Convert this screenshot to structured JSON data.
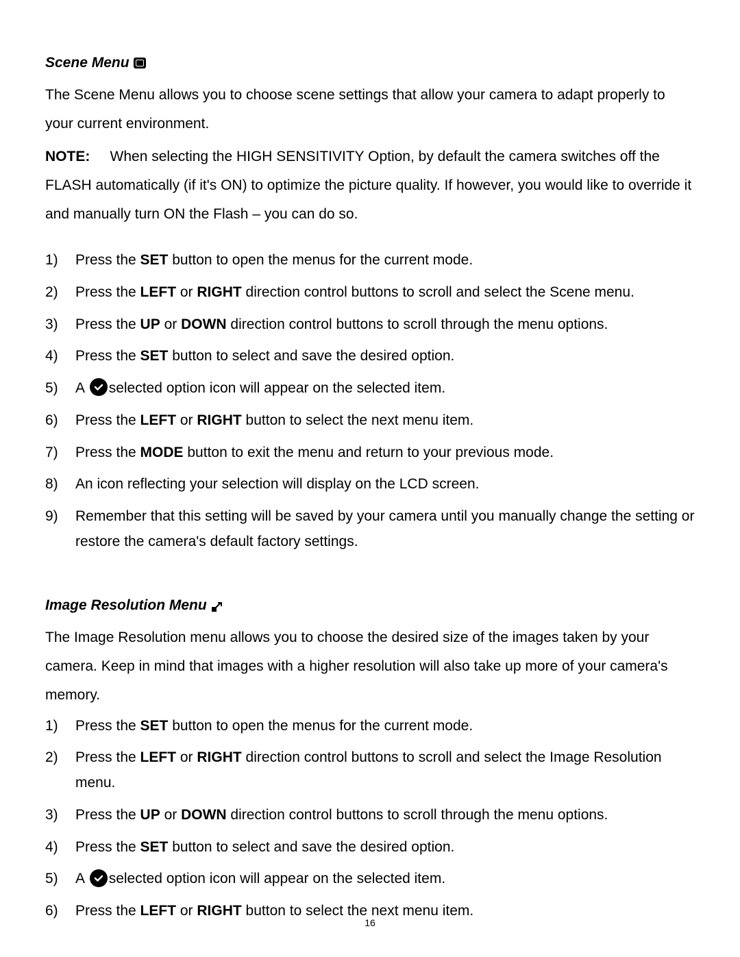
{
  "section1": {
    "heading": "Scene Menu",
    "intro": "The Scene Menu allows you to choose scene settings that allow your camera to adapt properly to your current environment.",
    "noteLabel": "NOTE:",
    "noteText": "When selecting the HIGH SENSITIVITY Option, by default the camera switches off the FLASH automatically (if it's ON) to optimize the picture quality. If however, you would like to override it and manually turn ON the Flash – you can do so.",
    "steps": [
      {
        "n": "1)",
        "pre": "Press the ",
        "bold": "SET",
        "post": " button to open the menus for the current mode."
      },
      {
        "n": "2)",
        "pre": "Press the ",
        "bold": "LEFT",
        "mid": " or ",
        "bold2": "RIGHT",
        "post": " direction control buttons to scroll and select the Scene menu."
      },
      {
        "n": "3)",
        "pre": "Press the ",
        "bold": "UP",
        "mid": " or ",
        "bold2": "DOWN",
        "post": " direction control buttons to scroll through the menu options."
      },
      {
        "n": "4)",
        "pre": "Press the ",
        "bold": "SET",
        "post": " button to select and save the desired option."
      },
      {
        "n": "5)",
        "pre": "A ",
        "icon": true,
        "post": "selected option icon will appear on the selected item."
      },
      {
        "n": "6)",
        "pre": "Press the ",
        "bold": "LEFT",
        "mid": " or ",
        "bold2": "RIGHT",
        "post": " button to select the next menu item."
      },
      {
        "n": "7)",
        "pre": "Press the ",
        "bold": "MODE",
        "post": " button to exit the menu and return to your previous mode."
      },
      {
        "n": "8)",
        "text": "An icon reflecting your selection will display on the LCD screen."
      },
      {
        "n": "9)",
        "text": "Remember that this setting will be saved by your camera until you manually change the setting or restore the camera's default factory settings."
      }
    ]
  },
  "section2": {
    "heading": "Image Resolution Menu",
    "intro": "The Image Resolution menu allows you to choose the desired size of the images taken by your camera. Keep in mind that images with a higher resolution will also take up more of your camera's memory.",
    "steps": [
      {
        "n": "1)",
        "pre": "Press the ",
        "bold": "SET",
        "post": " button to open the menus for the current mode."
      },
      {
        "n": "2)",
        "pre": "Press the ",
        "bold": "LEFT",
        "mid": " or ",
        "bold2": "RIGHT",
        "post": " direction control buttons to scroll and select the Image Resolution menu."
      },
      {
        "n": "3)",
        "pre": "Press the ",
        "bold": "UP",
        "mid": " or ",
        "bold2": "DOWN",
        "post": " direction control buttons to scroll through the menu options."
      },
      {
        "n": "4)",
        "pre": "Press the ",
        "bold": "SET",
        "post": " button to select and save the desired option."
      },
      {
        "n": "5)",
        "pre": "A ",
        "icon": true,
        "post": "selected option icon will appear on the selected item."
      },
      {
        "n": "6)",
        "pre": "Press the ",
        "bold": "LEFT",
        "mid": " or ",
        "bold2": "RIGHT",
        "post": " button to select the next menu item."
      }
    ]
  },
  "pageNumber": "16"
}
